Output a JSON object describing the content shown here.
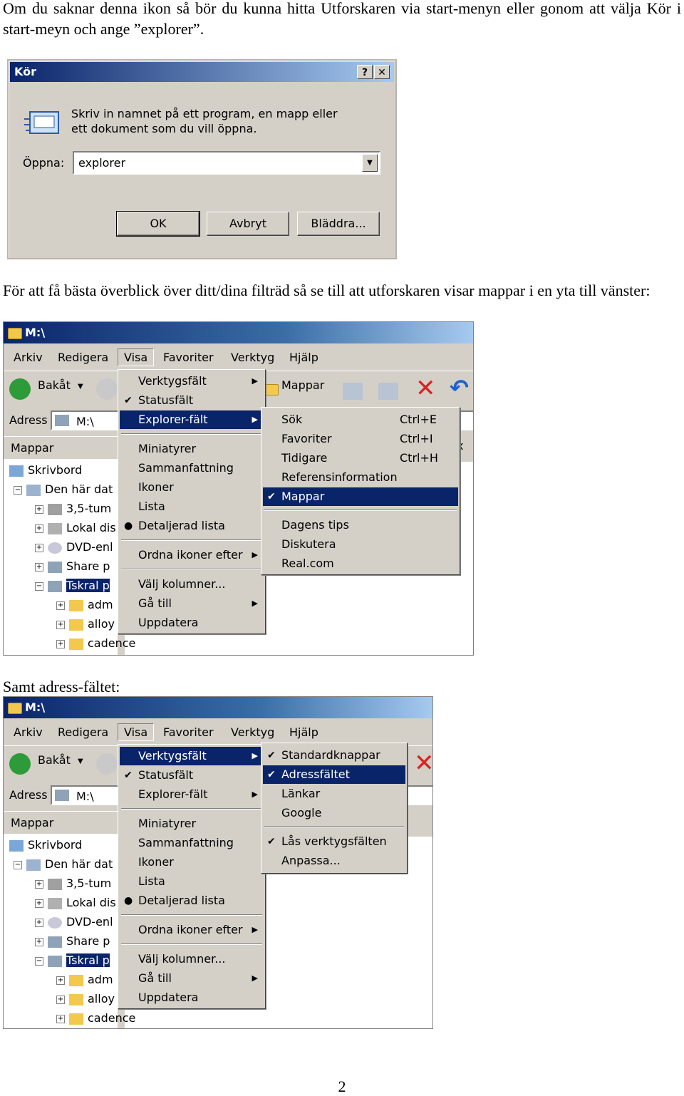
{
  "paragraphs": {
    "p1": "Om du saknar denna ikon så bör du kunna hitta Utforskaren via start-menyn eller gonom att välja Kör i start-meyn och ange ”explorer”.",
    "p2": "För att få bästa överblick över ditt/dina filträd så se till att utforskaren visar mappar i en yta till vänster:",
    "p3": "Samt adress-fältet:"
  },
  "run_dialog": {
    "title": "Kör",
    "help_btn": "?",
    "close_btn": "✕",
    "description": "Skriv in namnet på ett program, en mapp eller ett dokument som du vill öppna.",
    "open_label": "Öppna:",
    "open_value": "explorer",
    "ok": "OK",
    "cancel": "Avbryt",
    "browse": "Bläddra..."
  },
  "explorer": {
    "title": "M:\\",
    "menubar": [
      "Arkiv",
      "Redigera",
      "Visa",
      "Favoriter",
      "Verktyg",
      "Hjälp"
    ],
    "back": "Bakåt",
    "folders_btn": "Mappar",
    "address_label": "Adress",
    "address_value": "M:\\",
    "pane_header": "Mappar",
    "tree": [
      "Skrivbord",
      "Den här dat",
      "3,5-tum",
      "Lokal dis",
      "DVD-enl",
      "Share p",
      "Tskral p",
      "adm",
      "alloy",
      "cadence"
    ],
    "visa_menu": [
      "Verktygsfält",
      "Statusfält",
      "Explorer-fält",
      "Miniatyrer",
      "Sammanfattning",
      "Ikoner",
      "Lista",
      "Detaljerad lista",
      "Ordna ikoner efter",
      "Välj kolumner...",
      "Gå till",
      "Uppdatera"
    ],
    "explorer_bar_menu": [
      {
        "label": "Sök",
        "shortcut": "Ctrl+E"
      },
      {
        "label": "Favoriter",
        "shortcut": "Ctrl+I"
      },
      {
        "label": "Tidigare",
        "shortcut": "Ctrl+H"
      },
      {
        "label": "Referensinformation",
        "shortcut": ""
      },
      {
        "label": "Mappar",
        "shortcut": ""
      },
      {
        "label": "Dagens tips",
        "shortcut": ""
      },
      {
        "label": "Diskutera",
        "shortcut": ""
      },
      {
        "label": "Real.com",
        "shortcut": ""
      }
    ],
    "toolbars_menu": [
      "Standardknappar",
      "Adressfältet",
      "Länkar",
      "Google",
      "Lås verktygsfälten",
      "Anpassa..."
    ],
    "close_pane": "x"
  },
  "page_number": "2",
  "colors": {
    "highlight": "#0a246a",
    "face": "#d4d0c8"
  }
}
